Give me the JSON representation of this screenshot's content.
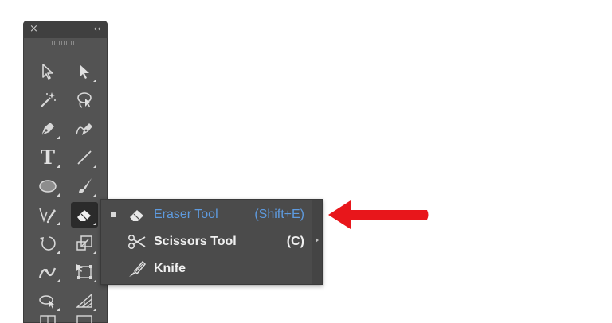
{
  "toolbar": {
    "close_glyph": "×",
    "collapse_glyph": "‹‹",
    "tools": [
      {
        "name": "direct-selection-tool",
        "icon": "hollow-arrow-icon"
      },
      {
        "name": "selection-tool",
        "icon": "solid-arrow-icon"
      },
      {
        "name": "magic-wand-tool",
        "icon": "magic-wand-icon"
      },
      {
        "name": "lasso-tool",
        "icon": "lasso-icon"
      },
      {
        "name": "pen-tool",
        "icon": "pen-icon"
      },
      {
        "name": "curvature-tool",
        "icon": "curvature-pen-icon"
      },
      {
        "name": "type-tool",
        "icon": "type-icon",
        "glyph": "T"
      },
      {
        "name": "line-segment-tool",
        "icon": "line-icon"
      },
      {
        "name": "ellipse-tool",
        "icon": "ellipse-icon"
      },
      {
        "name": "paintbrush-tool",
        "icon": "brush-icon"
      },
      {
        "name": "shaper-tool",
        "icon": "shaper-icon"
      },
      {
        "name": "eraser-tool",
        "icon": "eraser-icon",
        "selected": true
      },
      {
        "name": "rotate-tool",
        "icon": "rotate-icon"
      },
      {
        "name": "scale-tool",
        "icon": "scale-icon"
      },
      {
        "name": "width-tool",
        "icon": "width-icon"
      },
      {
        "name": "free-transform-tool",
        "icon": "free-transform-icon"
      },
      {
        "name": "shape-builder-tool",
        "icon": "shape-builder-icon"
      },
      {
        "name": "perspective-grid-tool",
        "icon": "perspective-grid-icon"
      }
    ]
  },
  "flyout": {
    "items": [
      {
        "label": "Eraser Tool",
        "shortcut": "(Shift+E)",
        "icon": "eraser-icon",
        "active": true
      },
      {
        "label": "Scissors Tool",
        "shortcut": "(C)",
        "icon": "scissors-icon",
        "active": false
      },
      {
        "label": "Knife",
        "shortcut": "",
        "icon": "knife-icon",
        "active": false
      }
    ]
  },
  "colors": {
    "toolbar_bg": "#535353",
    "flyout_bg": "#4b4b4b",
    "active_text": "#5e9be0",
    "annotation_arrow": "#e8161b"
  }
}
